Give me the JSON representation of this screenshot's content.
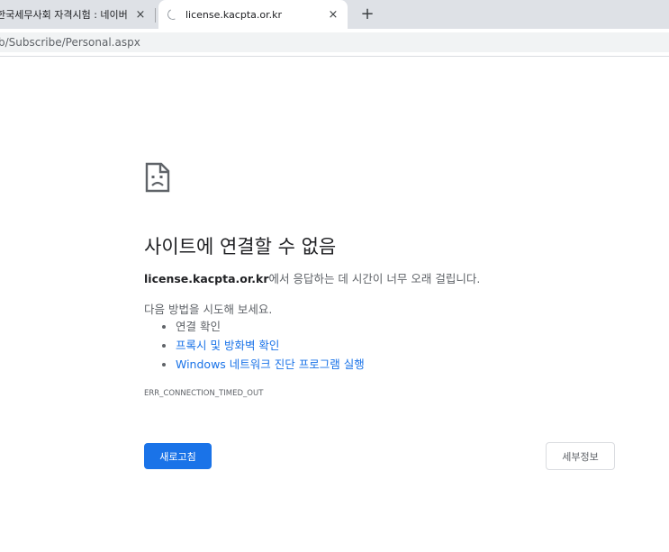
{
  "tabs": [
    {
      "title": "한국세무사회 자격시험 : 네이버",
      "close": "×",
      "state": "inactive"
    },
    {
      "title": "license.kacpta.or.kr",
      "close": "×",
      "state": "loading"
    }
  ],
  "new_tab_label": "+",
  "address_bar": {
    "url": "b/Subscribe/Personal.aspx"
  },
  "error_page": {
    "icon": "sad-page-icon",
    "heading": "사이트에 연결할 수 없음",
    "host": "license.kacpta.or.kr",
    "summary_suffix": "에서 응답하는 데 시간이 너무 오래 걸립니다.",
    "suggestions_intro": "다음 방법을 시도해 보세요.",
    "suggestions": [
      {
        "label": "연결 확인",
        "link": false
      },
      {
        "label": "프록시 및 방화벽 확인",
        "link": true
      },
      {
        "label": "Windows 네트워크 진단 프로그램 실행",
        "link": true
      }
    ],
    "error_code": "ERR_CONNECTION_TIMED_OUT",
    "reload_label": "새로고침",
    "details_label": "세부정보"
  },
  "colors": {
    "accent": "#1a73e8",
    "text_primary": "#202124",
    "text_secondary": "#5f6368",
    "tabstrip": "#dee1e6"
  }
}
